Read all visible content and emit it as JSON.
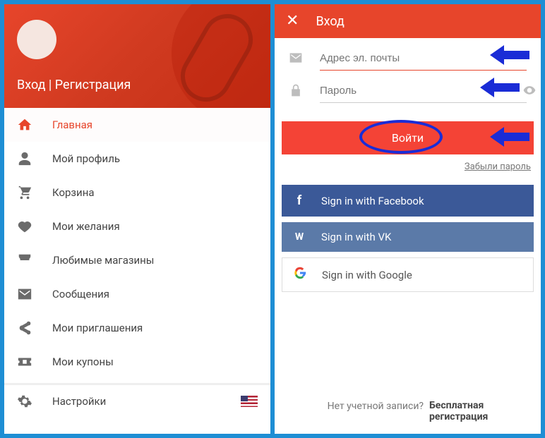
{
  "left": {
    "header_title": "Вход | Регистрация",
    "items": [
      {
        "icon": "home",
        "label": "Главная"
      },
      {
        "icon": "person",
        "label": "Мой профиль"
      },
      {
        "icon": "cart",
        "label": "Корзина"
      },
      {
        "icon": "heart",
        "label": "Мои желания"
      },
      {
        "icon": "store",
        "label": "Любимые магазины"
      },
      {
        "icon": "mail",
        "label": "Сообщения"
      },
      {
        "icon": "share",
        "label": "Мои приглашения"
      },
      {
        "icon": "coupon",
        "label": "Мои купоны"
      }
    ],
    "settings_label": "Настройки"
  },
  "right": {
    "title": "Вход",
    "email_placeholder": "Адрес эл. почты",
    "password_placeholder": "Пароль",
    "login_label": "Войти",
    "forgot_label": "Забыли пароль",
    "fb_label": "Sign in with Facebook",
    "vk_label": "Sign in with VK",
    "gg_label": "Sign in with Google",
    "noacct_text": "Нет учетной записи?",
    "register_label": "Бесплатная\nрегистрация"
  },
  "colors": {
    "brand": "#e7452b",
    "fb": "#3b5998",
    "vk": "#5b7aa8",
    "annotation": "#1a2cd6"
  }
}
